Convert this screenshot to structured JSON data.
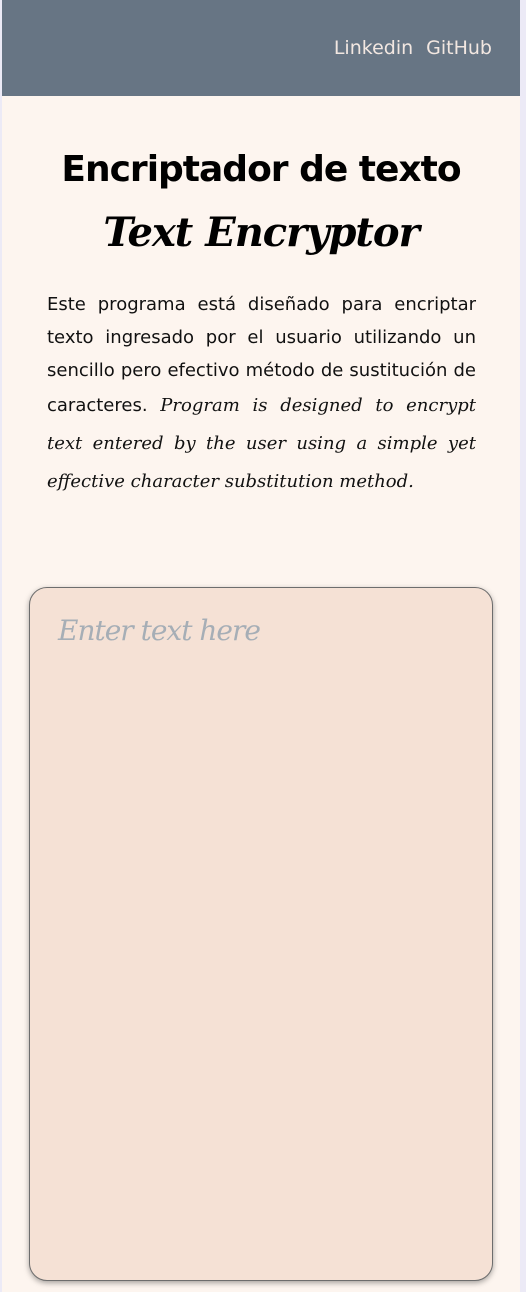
{
  "nav": {
    "links": [
      "Linkedin",
      "GitHub"
    ]
  },
  "header": {
    "title": "Encriptador de texto",
    "subtitle": "Text Encryptor"
  },
  "description": {
    "spanish": "Este programa está diseñado para encriptar texto ingresado por el usuario utilizando un sencillo pero efectivo método de sustitución de caracteres.",
    "english": "Program is designed to encrypt text entered by the user using a simple yet effective character substitution method."
  },
  "input": {
    "value": "",
    "placeholder": "Enter text here"
  },
  "colors": {
    "topbar": "#677584",
    "background": "#FDF5EF",
    "textarea": "#F5E1D5"
  }
}
